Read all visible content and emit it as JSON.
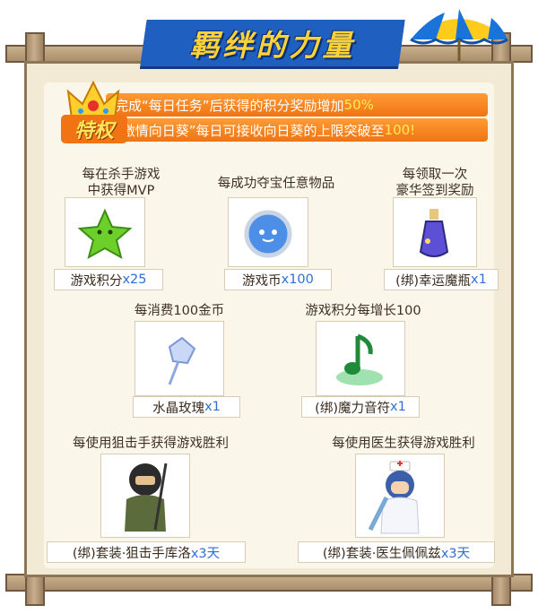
{
  "title": "羁绊的力量",
  "privilege": {
    "badge": "特权",
    "row1": {
      "text": "完成“每日任务”后获得的积分奖励增加",
      "highlight": "50%"
    },
    "row2": {
      "text": "“激情向日葵”每日可接收向日葵的上限突破至",
      "highlight": "100!"
    }
  },
  "rewards": [
    {
      "caption": "每在杀手游戏\n中获得MVP",
      "name": "游戏积分",
      "qty": "x25",
      "icon": "green-star-icon"
    },
    {
      "caption": "每成功夺宝任意物品",
      "name": "游戏币",
      "qty": "x100",
      "icon": "blue-coin-icon"
    },
    {
      "caption": "每领取一次\n豪华签到奖励",
      "name": "(绑)幸运魔瓶",
      "qty": "x1",
      "icon": "magic-bottle-icon"
    },
    {
      "caption": "每消费100金币",
      "name": "水晶玫瑰",
      "qty": "x1",
      "icon": "crystal-rose-icon"
    },
    {
      "caption": "游戏积分每增长100",
      "name": "(绑)魔力音符",
      "qty": "x1",
      "icon": "music-note-icon"
    },
    {
      "caption": "每使用狙击手获得游戏胜利",
      "name": "(绑)套装·狙击手库洛",
      "qty": "x3天",
      "icon": "sniper-avatar-icon"
    },
    {
      "caption": "每使用医生获得游戏胜利",
      "name": "(绑)套装·医生佩佩兹",
      "qty": "x3天",
      "icon": "nurse-avatar-icon"
    }
  ],
  "colors": {
    "accent": "#f07413",
    "highlight": "#ffeb55",
    "quantity": "#2f6fd6",
    "banner": "#1f5fbf"
  }
}
